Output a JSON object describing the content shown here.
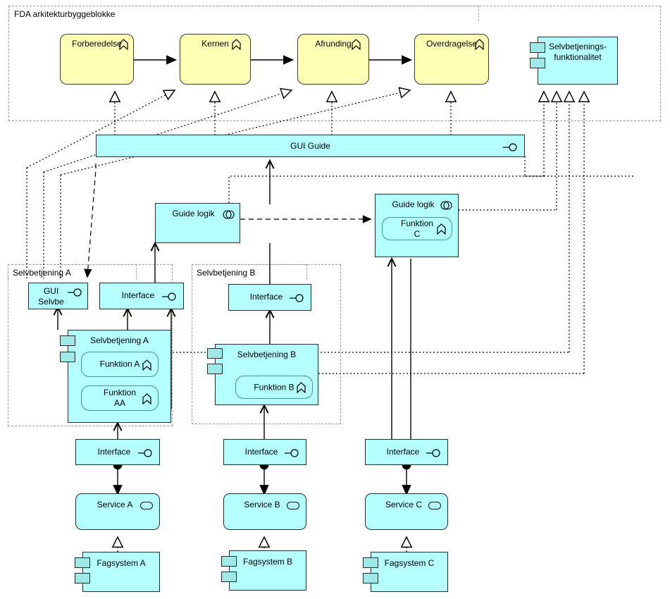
{
  "diagram": {
    "title": "FDA arkitekturbyggeblokke",
    "colors": {
      "process_fill": "#FFFFB5",
      "application_fill": "#B4FFFF",
      "component_tab_fill": "#9FE8E8",
      "group_border": "#9A9A9A",
      "line": "#000000"
    }
  },
  "groups": [
    {
      "id": "fda",
      "label": "FDA arkitekturbyggeblokke"
    },
    {
      "id": "selvA",
      "label": "Selvbetjening A"
    },
    {
      "id": "selvB",
      "label": "Selvbetjening B"
    }
  ],
  "processes": [
    {
      "id": "forberedelse",
      "label": "Forberedelse",
      "icon": "process-chevron-icon"
    },
    {
      "id": "kernen",
      "label": "Kernen",
      "icon": "process-chevron-icon"
    },
    {
      "id": "afrunding",
      "label": "Afrunding",
      "icon": "process-chevron-icon"
    },
    {
      "id": "overdragelse",
      "label": "Overdragelse",
      "icon": "process-chevron-icon"
    }
  ],
  "components": [
    {
      "id": "selvfunk",
      "label_line1": "Selvbetjenings-",
      "label_line2": "funktionalitet",
      "icon": "component-icon"
    },
    {
      "id": "selvA",
      "label": "Selvbetjening A",
      "icon": "component-icon"
    },
    {
      "id": "selvB",
      "label": "Selvbetjening B",
      "icon": "component-icon"
    },
    {
      "id": "fagA",
      "label": "Fagsystem A",
      "icon": "component-icon"
    },
    {
      "id": "fagB",
      "label": "Fagsystem B",
      "icon": "component-icon"
    },
    {
      "id": "fagC",
      "label": "Fagsystem C",
      "icon": "component-icon"
    }
  ],
  "interfaces": [
    {
      "id": "gui_guide",
      "label": "GUI Guide",
      "icon": "provided-interface-icon"
    },
    {
      "id": "gui_selvbe",
      "label_line1": "GUI",
      "label_line2": "Selvbe",
      "icon": "provided-interface-icon"
    },
    {
      "id": "if_a_top",
      "label": "Interface",
      "icon": "provided-interface-icon"
    },
    {
      "id": "if_b_top",
      "label": "Interface",
      "icon": "provided-interface-icon"
    },
    {
      "id": "if_a_bot",
      "label": "Interface",
      "icon": "provided-interface-icon"
    },
    {
      "id": "if_b_bot",
      "label": "Interface",
      "icon": "provided-interface-icon"
    },
    {
      "id": "if_c_bot",
      "label": "Interface",
      "icon": "provided-interface-icon"
    }
  ],
  "logic_blocks": [
    {
      "id": "guide_logik_left",
      "label": "Guide logik",
      "icon": "application-function-icon"
    },
    {
      "id": "guide_logik_right",
      "label": "Guide logik",
      "icon": "application-function-icon"
    }
  ],
  "functions": [
    {
      "id": "funkA",
      "label": "Funktion A",
      "icon": "function-chevron-icon"
    },
    {
      "id": "funkAA",
      "label": "Funktion AA",
      "icon": "function-chevron-icon"
    },
    {
      "id": "funkB",
      "label": "Funktion B",
      "icon": "function-chevron-icon"
    },
    {
      "id": "funkC",
      "label": "Funktion C",
      "icon": "function-chevron-icon"
    }
  ],
  "services": [
    {
      "id": "svcA",
      "label": "Service A",
      "icon": "application-service-icon"
    },
    {
      "id": "svcB",
      "label": "Service B",
      "icon": "application-service-icon"
    },
    {
      "id": "svcC",
      "label": "Service C",
      "icon": "application-service-icon"
    }
  ]
}
